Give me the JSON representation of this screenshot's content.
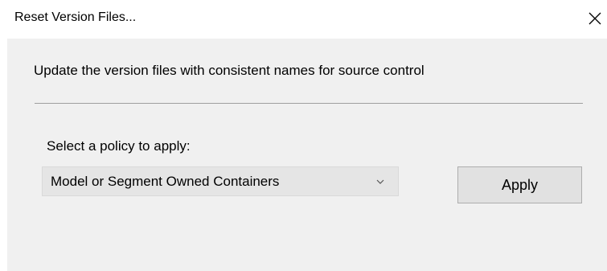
{
  "window": {
    "title": "Reset Version Files..."
  },
  "dialog": {
    "description": "Update the version files with consistent names for source control",
    "policy_label": "Select a policy to apply:",
    "policy_selected": "Model or Segment Owned Containers",
    "apply_label": "Apply"
  },
  "icons": {
    "close": "close-icon",
    "dropdown": "chevron-down-icon"
  },
  "colors": {
    "dialog_background": "#f0f0f0",
    "button_background": "#e1e1e1",
    "button_border": "#adadad",
    "separator": "#a0a0a0"
  }
}
